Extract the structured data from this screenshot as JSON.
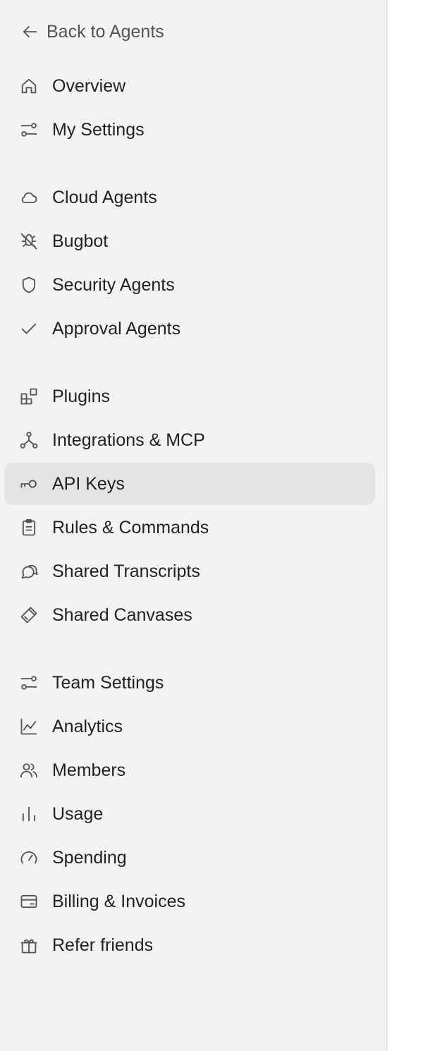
{
  "sidebar": {
    "back": {
      "label": "Back to Agents",
      "icon": "arrow-left-icon"
    },
    "groups": [
      {
        "items": [
          {
            "label": "Overview",
            "icon": "home-icon"
          },
          {
            "label": "My Settings",
            "icon": "sliders-icon"
          }
        ]
      },
      {
        "items": [
          {
            "label": "Cloud Agents",
            "icon": "cloud-icon"
          },
          {
            "label": "Bugbot",
            "icon": "bug-off-icon"
          },
          {
            "label": "Security Agents",
            "icon": "shield-icon"
          },
          {
            "label": "Approval Agents",
            "icon": "check-icon"
          }
        ]
      },
      {
        "items": [
          {
            "label": "Plugins",
            "icon": "blocks-icon"
          },
          {
            "label": "Integrations & MCP",
            "icon": "network-icon"
          },
          {
            "label": "API Keys",
            "icon": "key-icon",
            "active": true
          },
          {
            "label": "Rules & Commands",
            "icon": "clipboard-icon"
          },
          {
            "label": "Shared Transcripts",
            "icon": "chat-bubbles-icon"
          },
          {
            "label": "Shared Canvases",
            "icon": "brush-icon"
          }
        ]
      },
      {
        "items": [
          {
            "label": "Team Settings",
            "icon": "sliders-icon"
          },
          {
            "label": "Analytics",
            "icon": "chart-line-icon"
          },
          {
            "label": "Members",
            "icon": "users-icon"
          },
          {
            "label": "Usage",
            "icon": "bar-chart-icon"
          },
          {
            "label": "Spending",
            "icon": "gauge-icon"
          },
          {
            "label": "Billing & Invoices",
            "icon": "credit-card-icon"
          },
          {
            "label": "Refer friends",
            "icon": "gift-icon"
          }
        ]
      }
    ]
  },
  "colors": {
    "sidebar_bg": "#f3f3f3",
    "active_bg": "#e4e4e4",
    "text": "#222222",
    "icon": "#555555"
  }
}
